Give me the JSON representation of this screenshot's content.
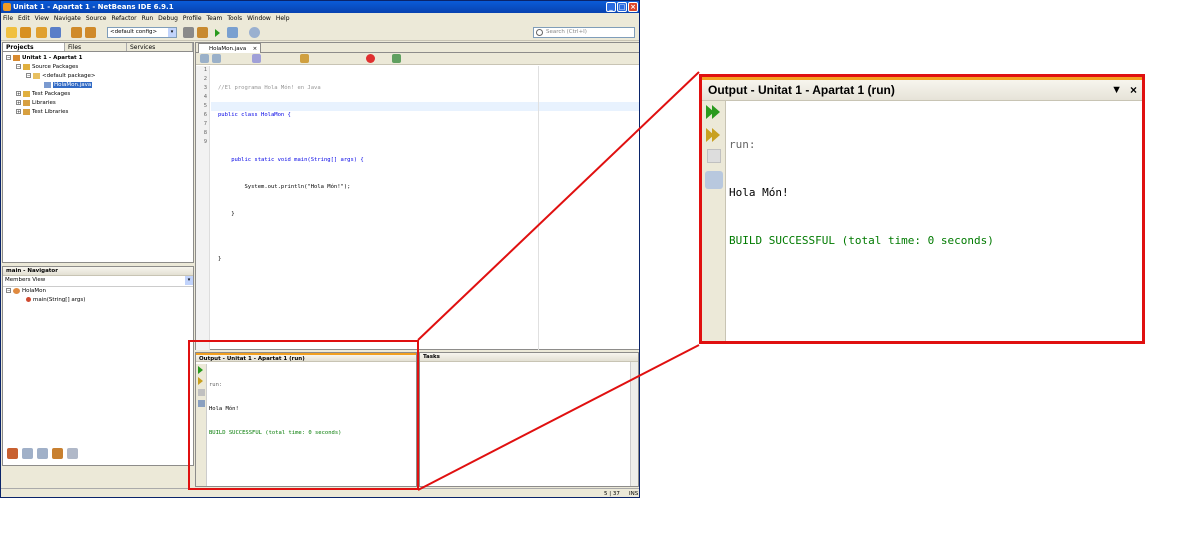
{
  "window": {
    "title": "Unitat 1 - Apartat 1 - NetBeans IDE 6.9.1",
    "minimize": "_",
    "maximize": "□",
    "close": "×"
  },
  "menu": [
    "File",
    "Edit",
    "View",
    "Navigate",
    "Source",
    "Refactor",
    "Run",
    "Debug",
    "Profile",
    "Team",
    "Tools",
    "Window",
    "Help"
  ],
  "toolbar": {
    "config_value": "<default config>",
    "search_placeholder": "Search (Ctrl+I)"
  },
  "projects_panel": {
    "tabs": [
      "Projects",
      "Files",
      "Services"
    ],
    "tree": {
      "project": "Unitat 1 - Apartat 1",
      "source_packages": "Source Packages",
      "default_package": "<default package>",
      "file": "HolaMon.java",
      "test_packages": "Test Packages",
      "libraries": "Libraries",
      "test_libraries": "Test Libraries"
    }
  },
  "navigator_panel": {
    "title": "main - Navigator",
    "view": "Members View",
    "class_name": "HolaMon",
    "method": "main(String[] args)"
  },
  "editor": {
    "tab": "HolaMon.java",
    "line_numbers": [
      "1",
      "2",
      "3",
      "4",
      "5",
      "6",
      "7",
      "8",
      "9"
    ],
    "code": [
      "//El programa Hola Món! en Java",
      "public class HolaMon {",
      "",
      "    public static void main(String[] args) {",
      "        System.out.println(\"Hola Món!\");",
      "    }",
      "",
      "}",
      ""
    ]
  },
  "output": {
    "title": "Output - Unitat 1 - Apartat 1 (run)",
    "lines": [
      "run:",
      "Hola Món!",
      "BUILD SUCCESSFUL (total time: 0 seconds)"
    ]
  },
  "tasks": {
    "title": "Tasks"
  },
  "status": {
    "position": "5 | 37",
    "mode": "INS"
  },
  "zoom_output": {
    "title": "Output - Unitat 1 - Apartat 1 (run)",
    "lines": [
      "run:",
      "Hola Món!",
      "BUILD SUCCESSFUL (total time: 0 seconds)"
    ]
  },
  "colors": {
    "highlight": "#e01010",
    "build_success": "#007a00",
    "keyword": "#0000e6"
  }
}
